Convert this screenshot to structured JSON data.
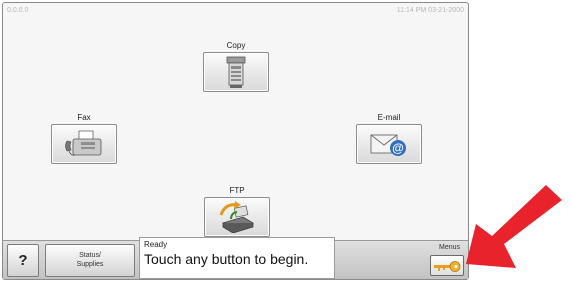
{
  "header": {
    "ip": "0.0.0.0",
    "datetime": "11:14 PM 03-21-2000"
  },
  "functions": {
    "copy": {
      "label": "Copy"
    },
    "fax": {
      "label": "Fax"
    },
    "email": {
      "label": "E-mail"
    },
    "ftp": {
      "label": "FTP"
    }
  },
  "bottom_bar": {
    "help_label": "?",
    "status_line1": "Status/",
    "status_line2": "Supplies",
    "message_status": "Ready",
    "message_text": "Touch any button to begin.",
    "menus_label": "Menus"
  },
  "colors": {
    "annotation_arrow": "#e8232b"
  }
}
